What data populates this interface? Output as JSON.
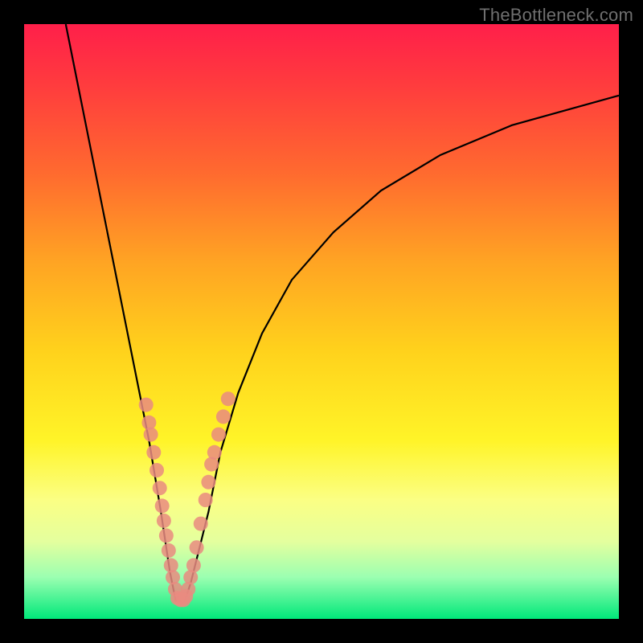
{
  "watermark": "TheBottleneck.com",
  "chart_data": {
    "type": "line",
    "title": "",
    "xlabel": "",
    "ylabel": "",
    "xlim": [
      0,
      100
    ],
    "ylim": [
      0,
      100
    ],
    "grid": false,
    "legend": false,
    "gradient_background": {
      "top": "#ff1f4a",
      "bottom": "#00e87a"
    },
    "series": [
      {
        "name": "left-curve",
        "x": [
          7,
          9,
          11,
          13,
          15,
          17,
          19,
          21,
          23,
          24.5,
          25.5
        ],
        "values": [
          100,
          90,
          80,
          70,
          60,
          50,
          40,
          30,
          18,
          8,
          3
        ]
      },
      {
        "name": "right-curve",
        "x": [
          27,
          28,
          29,
          31,
          33,
          36,
          40,
          45,
          52,
          60,
          70,
          82,
          100
        ],
        "values": [
          3,
          6,
          10,
          18,
          28,
          38,
          48,
          57,
          65,
          72,
          78,
          83,
          88
        ]
      }
    ],
    "flat_bottom": {
      "x_start": 25.5,
      "x_end": 27,
      "y": 3
    },
    "dots": [
      {
        "x": 20.5,
        "y": 36
      },
      {
        "x": 21.0,
        "y": 33
      },
      {
        "x": 21.3,
        "y": 31
      },
      {
        "x": 21.8,
        "y": 28
      },
      {
        "x": 22.3,
        "y": 25
      },
      {
        "x": 22.8,
        "y": 22
      },
      {
        "x": 23.2,
        "y": 19
      },
      {
        "x": 23.5,
        "y": 16.5
      },
      {
        "x": 23.9,
        "y": 14
      },
      {
        "x": 24.3,
        "y": 11.5
      },
      {
        "x": 24.7,
        "y": 9
      },
      {
        "x": 25.0,
        "y": 7
      },
      {
        "x": 25.4,
        "y": 5
      },
      {
        "x": 25.8,
        "y": 3.5
      },
      {
        "x": 26.3,
        "y": 3.2
      },
      {
        "x": 26.8,
        "y": 3.2
      },
      {
        "x": 27.2,
        "y": 3.8
      },
      {
        "x": 27.6,
        "y": 5
      },
      {
        "x": 28.0,
        "y": 7
      },
      {
        "x": 28.5,
        "y": 9
      },
      {
        "x": 29.0,
        "y": 12
      },
      {
        "x": 29.7,
        "y": 16
      },
      {
        "x": 30.5,
        "y": 20
      },
      {
        "x": 31.0,
        "y": 23
      },
      {
        "x": 31.5,
        "y": 26
      },
      {
        "x": 32.0,
        "y": 28
      },
      {
        "x": 32.7,
        "y": 31
      },
      {
        "x": 33.5,
        "y": 34
      },
      {
        "x": 34.3,
        "y": 37
      }
    ],
    "dot_color": "#e98b80",
    "dot_radius": 9
  }
}
